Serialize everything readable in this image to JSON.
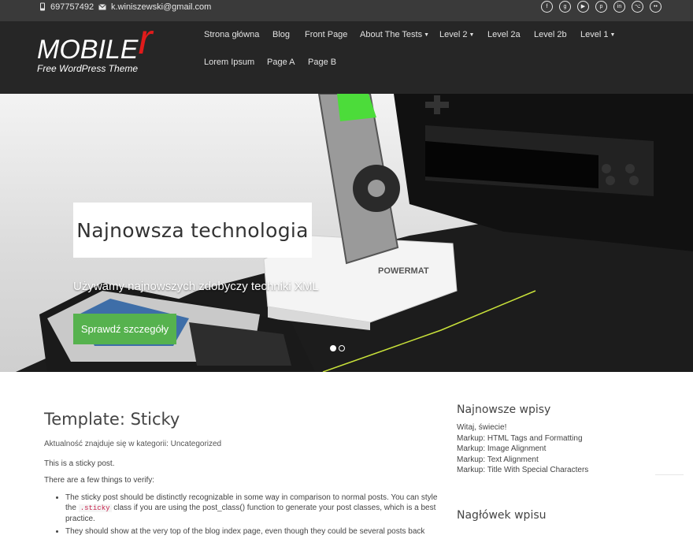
{
  "topbar": {
    "phone": "697757492",
    "email": "k.winiszewski@gmail.com",
    "socials": [
      {
        "icon": "facebook-icon",
        "glyph": "f"
      },
      {
        "icon": "googleplus-icon",
        "glyph": "g"
      },
      {
        "icon": "youtube-icon",
        "glyph": "▶"
      },
      {
        "icon": "pinterest-icon",
        "glyph": "p"
      },
      {
        "icon": "linkedin-icon",
        "glyph": "in"
      },
      {
        "icon": "github-icon",
        "glyph": "⌥"
      },
      {
        "icon": "flickr-icon",
        "glyph": "••"
      }
    ]
  },
  "logo": {
    "main": "MOBILE",
    "accent": "r",
    "tagline": "Free WordPress Theme",
    "accent_color": "#e01b1b"
  },
  "nav": {
    "items": [
      {
        "label": "Strona główna",
        "dropdown": false
      },
      {
        "label": "Blog",
        "dropdown": false
      },
      {
        "label": "Front Page",
        "dropdown": false
      },
      {
        "label": "About The Tests",
        "dropdown": true
      },
      {
        "label": "Level 2",
        "dropdown": true
      },
      {
        "label": "Level 2a",
        "dropdown": false
      },
      {
        "label": "Level 2b",
        "dropdown": false
      },
      {
        "label": "Level 1",
        "dropdown": true
      },
      {
        "label": "Lorem Ipsum",
        "dropdown": false
      },
      {
        "label": "Page A",
        "dropdown": false
      },
      {
        "label": "Page B",
        "dropdown": false
      }
    ]
  },
  "hero": {
    "title": "Najnowsza technologia",
    "subtitle": "Używamy najnowszych zdobyczy techniki XML",
    "button": "Sprawdź szczegóły",
    "button_color": "#56b24e",
    "brand_text": "POWERMAT",
    "slides": 2,
    "active_slide": 1
  },
  "post": {
    "title": "Template: Sticky",
    "meta": "Aktualność znajduje się w kategorii: Uncategorized",
    "para1": "This is a sticky post.",
    "para2": "There are a few things to verify:",
    "bullet1_a": "The sticky post should be distinctly recognizable in some way in comparison to normal posts. You can style the ",
    "bullet1_code": ".sticky",
    "bullet1_b": " class if you are using the post_class() function to generate your post classes, which is a best practice.",
    "bullet2": "They should show at the very top of the blog index page, even though they could be several posts back"
  },
  "sidebar": {
    "widget1_title": "Najnowsze wpisy",
    "recent_posts": [
      "Witaj, świecie!",
      "Markup: HTML Tags and Formatting",
      "Markup: Image Alignment",
      "Markup: Text Alignment",
      "Markup: Title With Special Characters"
    ],
    "widget2_title": "Nagłówek wpisu"
  }
}
